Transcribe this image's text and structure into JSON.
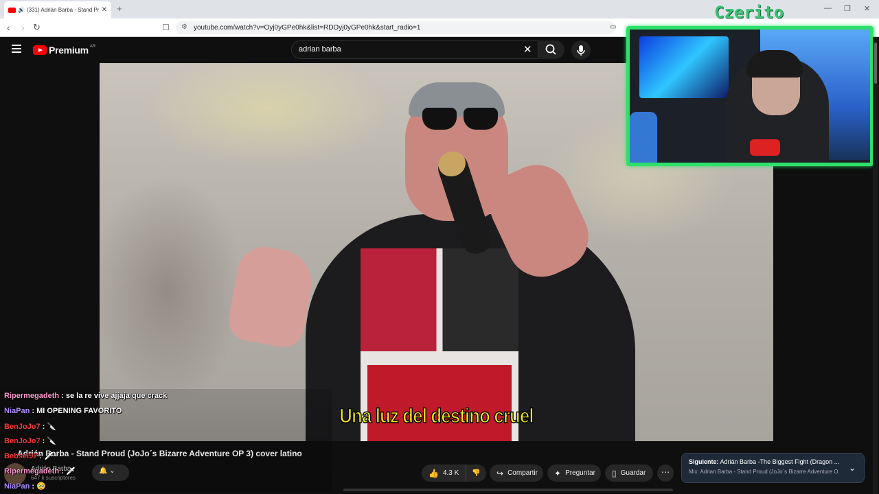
{
  "browser": {
    "tab_title": "(331) Adrián Barba - Stand Pr",
    "url": "youtube.com/watch?v=Oyj0yGPe0hk&list=RDOyj0yGPe0hk&start_radio=1"
  },
  "youtube": {
    "logo_text": "Premium",
    "region": "AR",
    "search_value": "adrian barba"
  },
  "video": {
    "subtitle": "Una luz del destino cruel",
    "title": "Adrián Barba - Stand Proud (JoJo´s Bizarre Adventure OP 3) cover latino",
    "channel": "Adrián Barba",
    "subscribers": "647 k suscriptores"
  },
  "actions": {
    "likes": "4.3 K",
    "share": "Compartir",
    "ask": "Preguntar",
    "save": "Guardar"
  },
  "next": {
    "label": "Siguiente:",
    "title": "Adrián Barba -The Biggest Fight (Dragon ...",
    "subtitle": "Mix: Adrian Barba - Stand Proud (JoJo´s Bizarre Adventure O..."
  },
  "stream": {
    "streamer_name": "Czerito"
  },
  "chat": [
    {
      "user": "Ripermegadeth",
      "message": "se la re vive ajjaja que crack",
      "color": "#ff9ad0"
    },
    {
      "user": "NiaPan",
      "message": "MI OPENING FAVORITO",
      "color": "#b08cff"
    },
    {
      "user": "BenJoJo7",
      "message": "🔪",
      "color": "#ff3b3b"
    },
    {
      "user": "BenJoJo7",
      "message": "🔪",
      "color": "#ff3b3b"
    },
    {
      "user": "Bebsel97",
      "message": "🗡",
      "color": "#ff3b3b"
    },
    {
      "user": "Ripermegadeth",
      "message": "🗡",
      "color": "#ff9ad0"
    },
    {
      "user": "NiaPan",
      "message": "🥹",
      "color": "#b08cff"
    }
  ],
  "colors": {
    "accent": "#ff0000",
    "cam_border": "#2ee06a",
    "subtitle": "#f2e820"
  }
}
